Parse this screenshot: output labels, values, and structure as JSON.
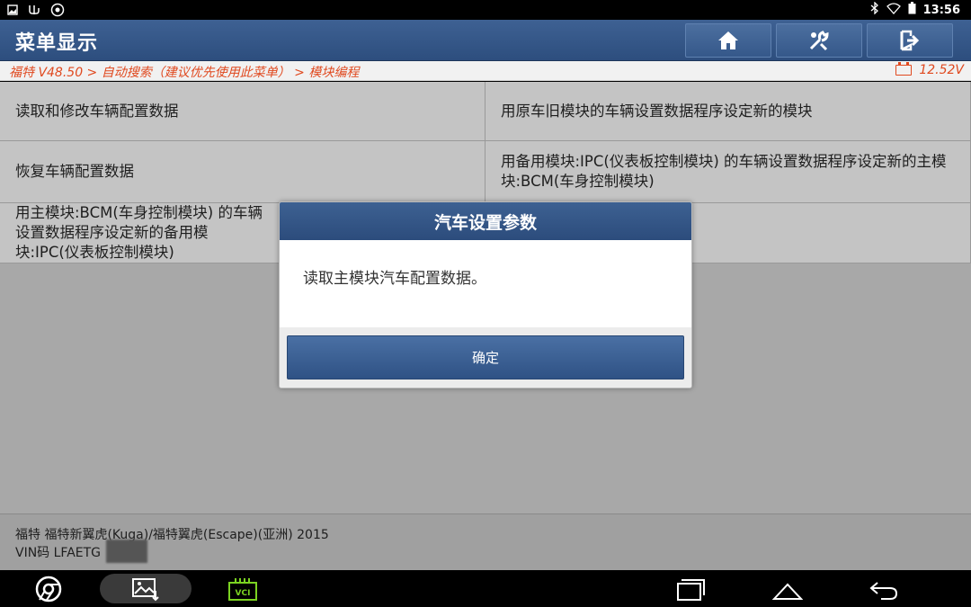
{
  "status_bar": {
    "time": "13:56",
    "left_icons": [
      "image-icon",
      "usb-icon",
      "settings-badge-icon"
    ],
    "right_icons": [
      "bluetooth-icon",
      "wifi-icon",
      "battery-icon"
    ]
  },
  "header": {
    "title": "菜单显示",
    "buttons": [
      "home-icon",
      "diagnostic-tools-icon",
      "exit-icon"
    ]
  },
  "breadcrumb": {
    "path": "福特 V48.50 > 自动搜索（建议优先使用此菜单） > 模块编程",
    "voltage": "12.52V"
  },
  "menu": {
    "items": [
      "读取和修改车辆配置数据",
      "用原车旧模块的车辆设置数据程序设定新的模块",
      "恢复车辆配置数据",
      "用备用模块:IPC(仪表板控制模块) 的车辆设置数据程序设定新的主模块:BCM(车身控制模块)",
      "用主模块:BCM(车身控制模块) 的车辆设置数据程序设定新的备用模块:IPC(仪表板控制模块)"
    ]
  },
  "vehicle": {
    "model_line": "福特 福特新翼虎(Kuga)/福特翼虎(Escape)(亚洲) 2015",
    "vin_line": "VIN码 LFAETG"
  },
  "dialog": {
    "title": "汽车设置参数",
    "message": "读取主模块汽车配置数据。",
    "ok_label": "确定"
  },
  "navbar": {
    "buttons": [
      "chrome-icon",
      "gallery-icon",
      "vci-icon",
      "recent-apps-icon",
      "home-nav-icon",
      "back-icon"
    ],
    "vci_label": "VCI"
  },
  "colors": {
    "header_blue": "#2d4e7e",
    "breadcrumb_orange": "#e0491f",
    "menu_gray": "#c4c4c4",
    "vci_green": "#7bd321"
  }
}
